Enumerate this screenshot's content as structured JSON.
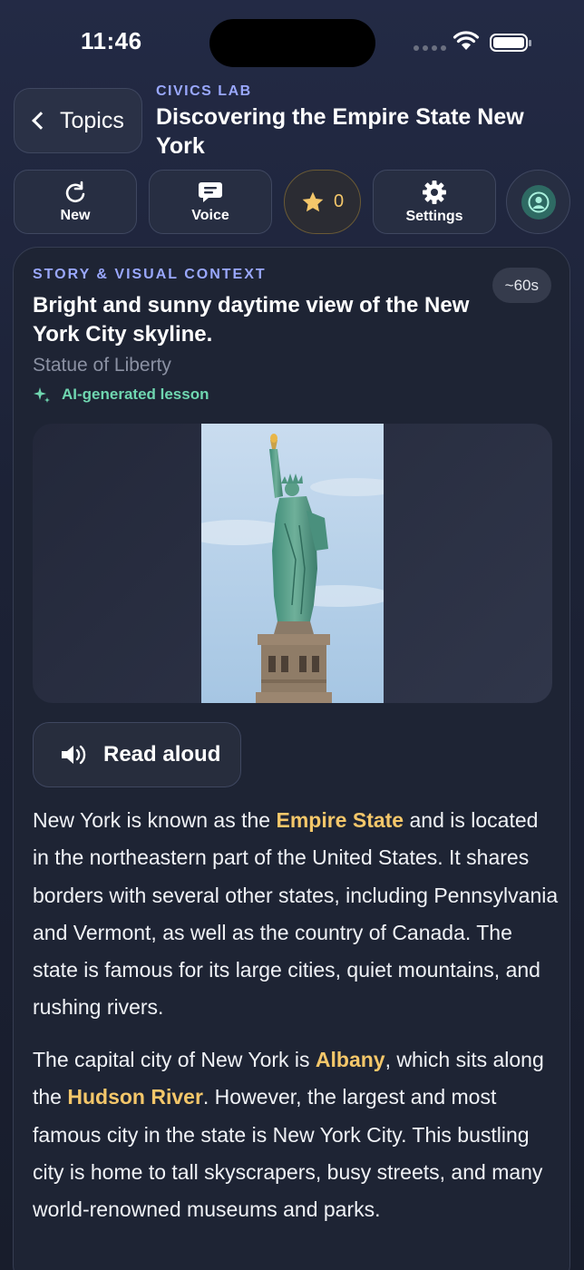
{
  "status": {
    "time": "11:46"
  },
  "header": {
    "back_label": "Topics",
    "eyebrow": "CIVICS LAB",
    "title": "Discovering the Empire State New York"
  },
  "toolbar": {
    "new_label": "New",
    "voice_label": "Voice",
    "stars_count": "0",
    "settings_label": "Settings"
  },
  "card": {
    "eyebrow": "STORY & VISUAL CONTEXT",
    "duration": "~60s",
    "title": "Bright and sunny daytime view of the New York City skyline.",
    "subtitle": "Statue of Liberty",
    "ai_label": "AI-generated lesson",
    "read_aloud": "Read aloud",
    "paragraphs": [
      {
        "t1": "New York is known as the ",
        "h1": "Empire State",
        "t2": " and is located in the northeastern part of the United States. It shares borders with several other states, including Pennsylvania and Vermont, as well as the country of Canada. The state is famous for its large cities, quiet mountains, and rushing rivers."
      },
      {
        "t1": "The capital city of New York is ",
        "h1": "Albany",
        "t2": ", which sits along the ",
        "h2": "Hudson River",
        "t3": ". However, the largest and most famous city in the state is New York City. This bustling city is home to tall skyscrapers, busy streets, and many world-renowned museums and parks."
      }
    ]
  },
  "colors": {
    "accent": "#9aa8ff",
    "highlight": "#f4c76a",
    "ai": "#6fd6b0"
  },
  "icons": [
    "chevron-left-icon",
    "refresh-icon",
    "chat-icon",
    "star-icon",
    "gear-icon",
    "user-icon",
    "sparkle-icon",
    "speaker-icon"
  ]
}
